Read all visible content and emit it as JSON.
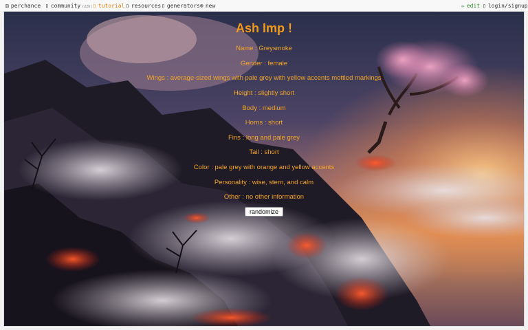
{
  "topbar": {
    "left": [
      {
        "icon": "die-icon",
        "glyph": "⚄",
        "label": "perchance"
      },
      {
        "icon": "person-icon",
        "glyph": "▯",
        "label": "community",
        "count": "(22h)"
      },
      {
        "icon": "book-icon",
        "glyph": "▯",
        "label": "tutorial"
      },
      {
        "icon": "book-icon",
        "glyph": "▯",
        "label": "resources"
      },
      {
        "icon": "gear-icon",
        "glyph": "▯",
        "label": "generators"
      },
      {
        "icon": "plus-circle-icon",
        "glyph": "⊕",
        "label": "new"
      }
    ],
    "right": [
      {
        "icon": "pencil-icon",
        "glyph": "✏",
        "label": "edit"
      },
      {
        "icon": "user-icon",
        "glyph": "▯",
        "label": "login/signup"
      }
    ]
  },
  "generator": {
    "title": "Ash Imp !",
    "lines": [
      "Name : Greysmoke",
      "Gender : female",
      "Wings : average-sized wings with pale grey with yellow accents mottled markings",
      "Height : slightly short",
      "Body : medium",
      "Horns : short",
      "Fins : long and pale grey",
      "Tail : short",
      "Color : pale grey with orange and yellow accents",
      "Personality : wise, stern, and calm",
      "Other : no other information"
    ],
    "button_label": "randomize"
  },
  "colors": {
    "accent_text": "#f4a526",
    "tutorial_link": "#d9800f",
    "edit_link": "#2e8b2e"
  }
}
